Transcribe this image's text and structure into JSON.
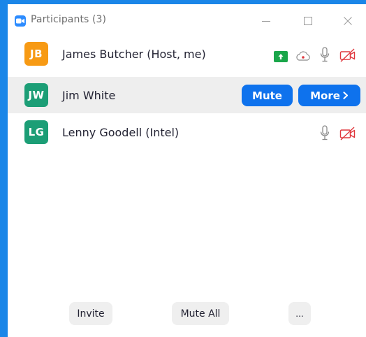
{
  "window": {
    "title": "Participants (3)"
  },
  "participants": [
    {
      "initials": "JB",
      "name": "James Butcher (Host, me)",
      "avatar_color": "#f79a14",
      "icons": [
        "share-screen-icon",
        "cloud-record-icon",
        "microphone-icon",
        "video-off-icon"
      ]
    },
    {
      "initials": "JW",
      "name": "Jim White",
      "avatar_color": "#1c9e76",
      "actions": {
        "mute_label": "Mute",
        "more_label": "More"
      }
    },
    {
      "initials": "LG",
      "name": "Lenny Goodell (Intel)",
      "avatar_color": "#1c9e76",
      "icons": [
        "microphone-icon",
        "video-off-icon"
      ]
    }
  ],
  "footer": {
    "invite_label": "Invite",
    "mute_all_label": "Mute All",
    "more_label": "..."
  },
  "colors": {
    "accent": "#0e72ed",
    "frame": "#1a86e8",
    "video_off": "#e0383e",
    "share": "#1aa64a"
  }
}
